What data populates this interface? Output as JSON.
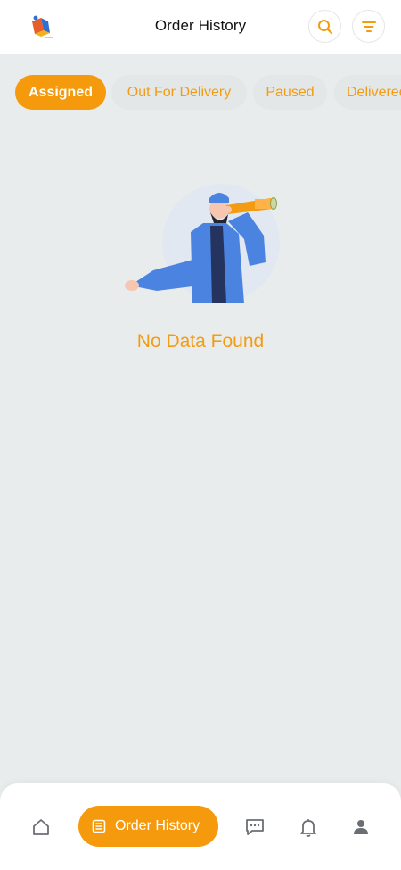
{
  "header": {
    "title": "Order History",
    "icons": {
      "search": "search-icon",
      "filter": "filter-icon",
      "logo": "app-logo"
    }
  },
  "tabs": [
    {
      "label": "Assigned",
      "active": true
    },
    {
      "label": "Out For Delivery",
      "active": false
    },
    {
      "label": "Paused",
      "active": false
    },
    {
      "label": "Delivered",
      "active": false
    }
  ],
  "empty_state": {
    "message": "No Data Found",
    "illustration": "man-with-telescope"
  },
  "bottom_nav": {
    "active_label": "Order History",
    "items": [
      "home-icon",
      "order-history-icon",
      "chat-icon",
      "bell-icon",
      "user-icon"
    ]
  },
  "colors": {
    "accent": "#f59a0c",
    "background": "#e8ecec",
    "surface": "#ffffff"
  }
}
